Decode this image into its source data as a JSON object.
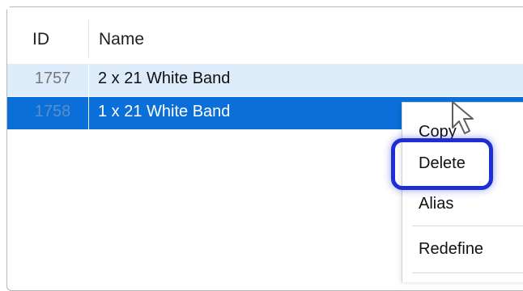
{
  "table": {
    "headers": {
      "id": "ID",
      "name": "Name"
    },
    "rows": [
      {
        "id": "1757",
        "name": "2 x 21 White Band",
        "state": "unselected"
      },
      {
        "id": "1758",
        "name": "1 x 21 White Band",
        "state": "selected"
      }
    ]
  },
  "context_menu": {
    "items": [
      {
        "label": "Copy"
      },
      {
        "label": "Delete",
        "highlighted": true
      },
      {
        "label": "Alias"
      },
      {
        "label": "Redefine"
      }
    ]
  },
  "colors": {
    "selected_row": "#0a6fd8",
    "hover_row": "#dcecfb",
    "highlight_outline": "#1d2fd4"
  },
  "icons": {
    "cursor": "mouse-pointer-icon"
  }
}
